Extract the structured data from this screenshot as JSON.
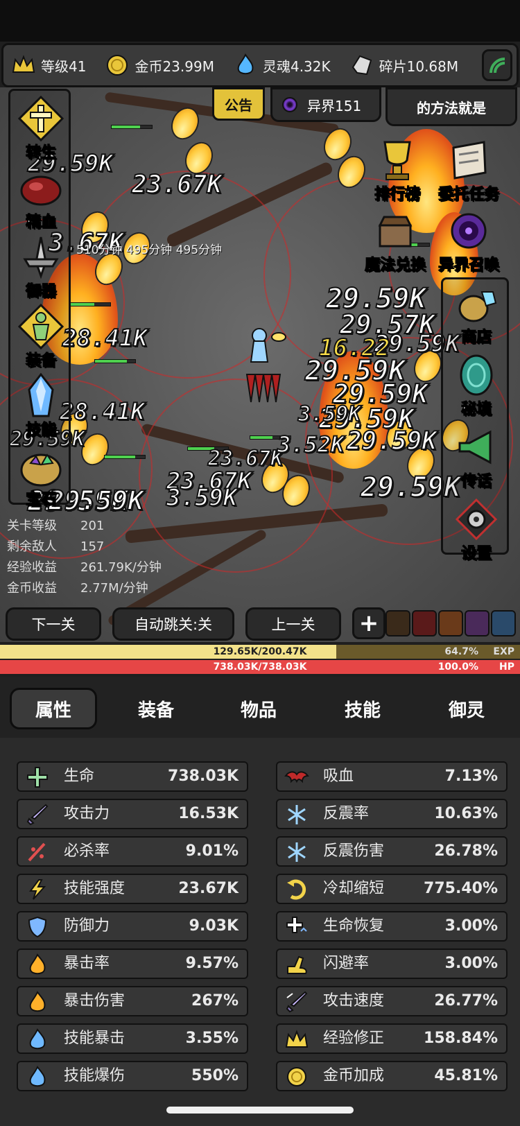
{
  "resources": [
    {
      "icon": "crown-icon",
      "label": "等级41"
    },
    {
      "icon": "gold-coin-icon",
      "label": "金币23.99M"
    },
    {
      "icon": "soul-flame-icon",
      "label": "灵魂4.32K"
    },
    {
      "icon": "fragment-icon",
      "label": "碎片10.68M"
    }
  ],
  "top_buttons": {
    "notice": "公告",
    "realm": "异界151",
    "marquee": "的方法就是"
  },
  "timer_text": "510分钟 495分钟 495分钟",
  "damage_numbers": [
    "29.59K",
    "29.57K",
    "29.59K",
    "29.59K",
    "29.59K",
    "29.59K",
    "29.59K",
    "29.59K",
    "29.59K",
    "29.59K",
    "23.67K",
    "3.67K",
    "28.41K",
    "28.41K",
    "23.67K",
    "23.67K",
    "29.59K",
    "16.22",
    "3.59K",
    "3.52K",
    "3.59K",
    "29.59K"
  ],
  "left_menu": [
    {
      "icon": "rebirth-cross-icon",
      "label": "转生"
    },
    {
      "icon": "blood-essence-icon",
      "label": "精血"
    },
    {
      "icon": "sword-guard-icon",
      "label": "御器"
    },
    {
      "icon": "equipment-figure-icon",
      "label": "装备"
    },
    {
      "icon": "skill-crystal-icon",
      "label": "技能"
    },
    {
      "icon": "gem-pouch-icon",
      "label": "宝石"
    }
  ],
  "right_menu": [
    {
      "icon": "trophy-icon",
      "label": "排行榜"
    },
    {
      "icon": "task-scroll-icon",
      "label": "委托任务"
    },
    {
      "icon": "magic-chest-icon",
      "label": "魔法兑换"
    },
    {
      "icon": "portal-vortex-icon",
      "label": "异界召唤"
    },
    {
      "icon": "shop-bag-icon",
      "label": "商店"
    },
    {
      "icon": "secret-realm-icon",
      "label": "秘境"
    },
    {
      "icon": "horn-icon",
      "label": "传话"
    },
    {
      "icon": "settings-gear-icon",
      "label": "设置"
    }
  ],
  "stage_info": [
    {
      "key": "关卡等级",
      "value": "201"
    },
    {
      "key": "剩余敌人",
      "value": "157"
    },
    {
      "key": "经验收益",
      "value": "261.79K/分钟"
    },
    {
      "key": "金币收益",
      "value": "2.77M/分钟"
    }
  ],
  "nav_buttons": {
    "next": "下一关",
    "auto": "自动跳关:关",
    "prev": "上一关",
    "plus": "+"
  },
  "exp_bar": {
    "text": "129.65K/200.47K",
    "percent_text": "64.7%",
    "tag": "EXP",
    "fraction": 0.647
  },
  "hp_bar": {
    "text": "738.03K/738.03K",
    "percent_text": "100.0%",
    "tag": "HP",
    "fraction": 1.0
  },
  "tabs": [
    "属性",
    "装备",
    "物品",
    "技能",
    "御灵"
  ],
  "active_tab": 0,
  "stats_left": [
    {
      "icon": "life-cross-icon",
      "name": "生命",
      "value": "738.03K"
    },
    {
      "icon": "sword-icon",
      "name": "攻击力",
      "value": "16.53K"
    },
    {
      "icon": "crit-slash-icon",
      "name": "必杀率",
      "value": "9.01%"
    },
    {
      "icon": "skill-lightning-icon",
      "name": "技能强度",
      "value": "23.67K"
    },
    {
      "icon": "shield-icon",
      "name": "防御力",
      "value": "9.03K"
    },
    {
      "icon": "crit-flame-icon",
      "name": "暴击率",
      "value": "9.57%"
    },
    {
      "icon": "crit-damage-flame-icon",
      "name": "暴击伤害",
      "value": "267%"
    },
    {
      "icon": "skill-crit-blue-flame-icon",
      "name": "技能暴击",
      "value": "3.55%"
    },
    {
      "icon": "skill-burst-blue-flame-icon",
      "name": "技能爆伤",
      "value": "550%"
    }
  ],
  "stats_right": [
    {
      "icon": "bat-icon",
      "name": "吸血",
      "value": "7.13%"
    },
    {
      "icon": "reflect-ice-icon",
      "name": "反震率",
      "value": "10.63%"
    },
    {
      "icon": "reflect-damage-ice-icon",
      "name": "反震伤害",
      "value": "26.78%"
    },
    {
      "icon": "cooldown-arrow-icon",
      "name": "冷却缩短",
      "value": "775.40%"
    },
    {
      "icon": "regen-cross-icon",
      "name": "生命恢复",
      "value": "3.00%"
    },
    {
      "icon": "dodge-boot-icon",
      "name": "闪避率",
      "value": "3.00%"
    },
    {
      "icon": "attack-speed-sword-icon",
      "name": "攻击速度",
      "value": "26.77%"
    },
    {
      "icon": "exp-crown-icon",
      "name": "经验修正",
      "value": "158.84%"
    },
    {
      "icon": "gold-coin-icon",
      "name": "金币加成",
      "value": "45.81%"
    }
  ],
  "colors": {
    "exp_fill": "#f3e28a",
    "hp_fill": "#e64646",
    "tab_active_bg": "#3a3a3a",
    "notice_bg": "#e3c23a"
  }
}
